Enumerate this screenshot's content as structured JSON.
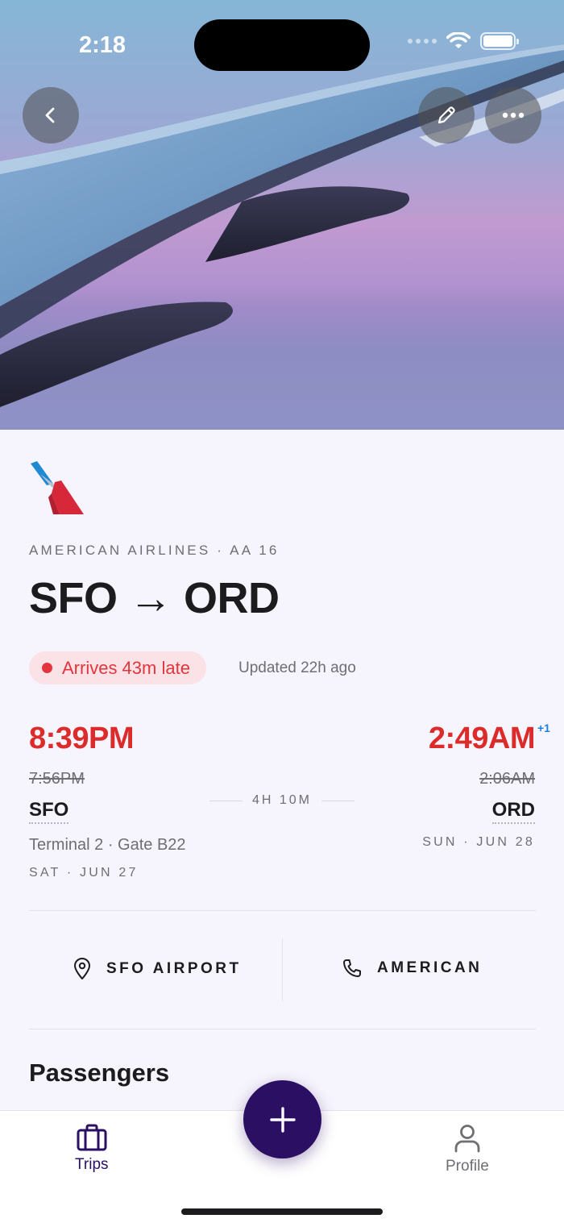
{
  "status_bar": {
    "time": "2:18"
  },
  "header": {
    "back_icon": "chevron-left-icon",
    "edit_icon": "pencil-icon",
    "more_icon": "ellipsis-icon"
  },
  "flight": {
    "airline_meta": "AMERICAN AIRLINES · AA 16",
    "route": "SFO → ORD",
    "status_label": "Arrives 43m late",
    "updated": "Updated 22h ago",
    "status_color": "#e2353c",
    "departure": {
      "time": "8:39PM",
      "scheduled": "7:56PM",
      "code": "SFO",
      "terminal_gate": "Terminal 2 · Gate B22",
      "date": "SAT · JUN 27"
    },
    "arrival": {
      "time": "2:49AM",
      "day_offset": "+1",
      "scheduled": "2:06AM",
      "code": "ORD",
      "date": "SUN · JUN 28"
    },
    "duration": "4H 10M"
  },
  "actions": {
    "airport_label": "SFO AIRPORT",
    "airline_label": "AMERICAN"
  },
  "sections": {
    "passengers_title": "Passengers"
  },
  "tabbar": {
    "trips_label": "Trips",
    "profile_label": "Profile",
    "active_color": "#2a0f63",
    "inactive_color": "#6e6e73"
  }
}
